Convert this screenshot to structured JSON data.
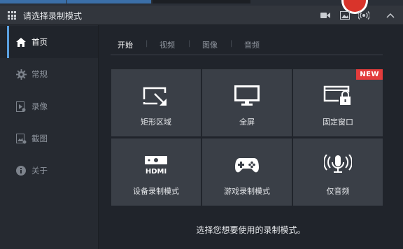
{
  "window": {
    "title": "请选择录制模式"
  },
  "titlebar_icons": [
    "video-camera-icon",
    "image-icon",
    "broadcast-icon",
    "collapse-icon"
  ],
  "sidebar": {
    "items": [
      {
        "label": "首页",
        "icon": "home-icon",
        "active": true
      },
      {
        "label": "常规",
        "icon": "gear-icon",
        "active": false
      },
      {
        "label": "录像",
        "icon": "video-file-icon",
        "active": false
      },
      {
        "label": "截图",
        "icon": "screenshot-icon",
        "active": false
      },
      {
        "label": "关于",
        "icon": "info-icon",
        "active": false
      }
    ]
  },
  "tabs": [
    {
      "label": "开始",
      "active": true
    },
    {
      "label": "视频",
      "active": false
    },
    {
      "label": "图像",
      "active": false
    },
    {
      "label": "音频",
      "active": false
    }
  ],
  "tiles": [
    {
      "label": "矩形区域",
      "icon": "rectangle-area-icon"
    },
    {
      "label": "全屏",
      "icon": "monitor-icon"
    },
    {
      "label": "固定窗口",
      "icon": "locked-window-icon",
      "badge": "NEW"
    },
    {
      "label": "设备录制模式",
      "icon": "hdmi-icon"
    },
    {
      "label": "游戏录制模式",
      "icon": "gamepad-icon"
    },
    {
      "label": "仅音频",
      "icon": "microphone-icon"
    }
  ],
  "hint": "选择您想要使用的录制模式。",
  "colors": {
    "accent": "#5aa0e0",
    "badge": "#e33c3c",
    "tile": "#3a3f47",
    "background": "#20242b"
  }
}
